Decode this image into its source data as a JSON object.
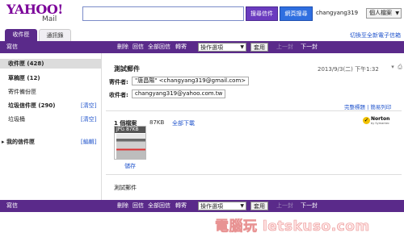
{
  "header": {
    "logo_text": "YAHOO!",
    "logo_sub": "Mail",
    "search_value": "",
    "search_mail_label": "搜尋信件",
    "search_web_label": "網頁搜尋",
    "username": "changyang319",
    "profile_label": "個人檔案"
  },
  "tabs": [
    {
      "label": "收件匣",
      "active": true
    },
    {
      "label": "通訊錄",
      "active": false
    }
  ],
  "switch_new_label": "切換至全新電子信箱",
  "toolbar": {
    "compose": "寫信",
    "delete": "刪除",
    "reply": "回信",
    "reply_all": "全部回信",
    "forward": "轉寄",
    "actions_select": "操作選項",
    "apply": "套用",
    "prev": "上一封",
    "next": "下一封"
  },
  "folders": [
    {
      "label": "收件匣 (428)",
      "selected": true
    },
    {
      "label": "草稿匣 (12)"
    },
    {
      "label": "寄件備份匣"
    },
    {
      "label": "垃圾信件匣 (290)",
      "action": "[清空]"
    },
    {
      "label": "垃圾桶",
      "action": "[清空]"
    }
  ],
  "my_folders": {
    "label": "我的信件匣",
    "action": "[編輯]"
  },
  "message": {
    "subject": "測試郵件",
    "date": "2013/9/3(二) 下午1:32",
    "from_label": "寄件者:",
    "from_value": "\"唐昌陽\" <changyang319@gmail.com>",
    "to_label": "收件者:",
    "to_value": "changyang319@yahoo.com.tw",
    "full_header": "完整標題",
    "printable": "簡易列印",
    "attachment_count": "1 個檔案",
    "attachment_size": "87KB",
    "download_all": "全部下載",
    "thumb_caption": "JPG    87KB",
    "save_link": "儲存",
    "body": "測試郵件",
    "norton": "Norton",
    "norton_sub": "by Symantec"
  },
  "watermark": "電腦玩 letskuso.com",
  "colors": {
    "toolbar": "#5a2a8a",
    "link": "#2255cc",
    "yahoo_purple": "#7b0099"
  }
}
